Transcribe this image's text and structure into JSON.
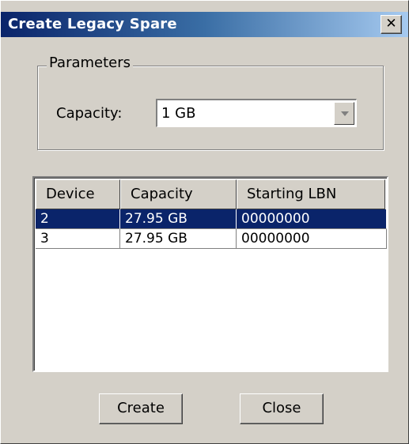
{
  "window": {
    "title": "Create Legacy Spare",
    "close_glyph": "✕"
  },
  "parameters": {
    "group_label": "Parameters",
    "capacity_label": "Capacity:",
    "capacity_value": "1 GB"
  },
  "table": {
    "columns": [
      "Device",
      "Capacity",
      "Starting LBN"
    ],
    "rows": [
      {
        "device": "2",
        "capacity": "27.95 GB",
        "starting_lbn": "00000000",
        "selected": true
      },
      {
        "device": "3",
        "capacity": "27.95 GB",
        "starting_lbn": "00000000",
        "selected": false
      }
    ]
  },
  "buttons": {
    "create_label": "Create",
    "close_label": "Close"
  },
  "colors": {
    "dialog_background": "#d4d0c8",
    "title_gradient_start": "#0a246a",
    "selection": "#0a246a"
  },
  "icons": {
    "close": "close-icon",
    "dropdown": "chevron-down-icon"
  }
}
